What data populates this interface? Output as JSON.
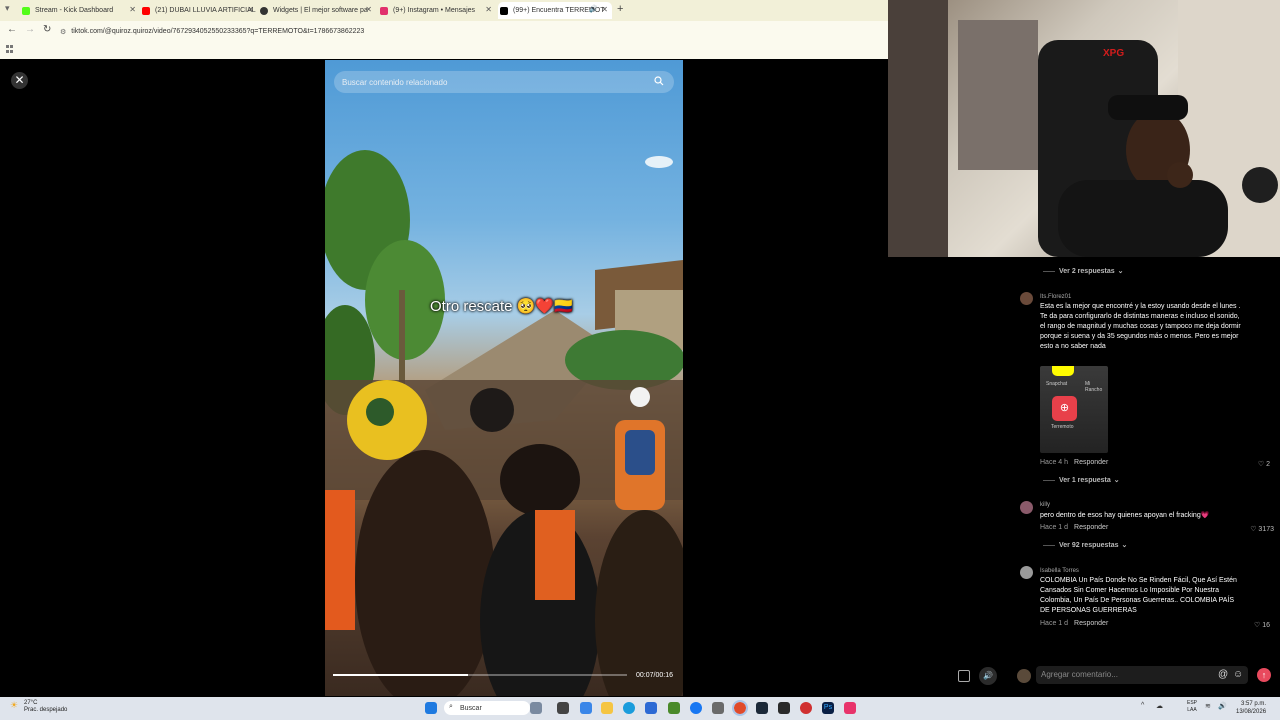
{
  "browser": {
    "tabs": [
      {
        "label": "Stream - Kick Dashboard",
        "icon": "kick-icon",
        "color": "#53fc18"
      },
      {
        "label": "(21) DUBAI LLUVIA ARTIFICIAL",
        "icon": "youtube-icon",
        "color": "#ff0000"
      },
      {
        "label": "Widgets | El mejor software pa",
        "icon": "widgets-icon",
        "color": "#333333"
      },
      {
        "label": "(9+) Instagram • Mensajes",
        "icon": "instagram-icon",
        "color": "#e1306c"
      },
      {
        "label": "(99+) Encuentra TERREMOT",
        "icon": "tiktok-icon",
        "color": "#000000"
      }
    ],
    "url": "tiktok.com/@quiroz.quiroz/video/7672934052550233365?q=TERREMOTO&t=1786673862223"
  },
  "video": {
    "search_placeholder": "Buscar contenido relacionado",
    "caption": "Otro rescate 🥺❤️🇨🇴",
    "time": "00:07/00:16",
    "progress": 0.46
  },
  "comments": {
    "toggle1": "Ver 2 respuestas",
    "c1": {
      "user": "Its.Florez01",
      "text": "Esta es la mejor que encontré y la estoy usando desde el lunes . Te da para configurarlo de distintas maneras e incluso el sonido, el rango de magnitud y muchas cosas y tampoco me deja dormir porque si suena y da 35 segundos más o menos. Pero es mejor esto a no saber nada",
      "thumb_labels": [
        "Snapchat",
        "Mi Rancho",
        "Terremoto"
      ],
      "time": "Hace 4 h",
      "reply": "Responder",
      "likes": "2"
    },
    "toggle2": "Ver 1 respuesta",
    "c2": {
      "user": "killy",
      "text": "pero dentro de esos hay quienes apoyan el fracking💗",
      "time": "Hace 1 d",
      "reply": "Responder",
      "likes": "3173"
    },
    "toggle3": "Ver 92 respuestas",
    "c3": {
      "user": "Isabella Torres",
      "text": "COLOMBIA Un País Donde No Se Rinden Fácil, Que Así Estén Cansados Sin Comer Hacemos Lo Imposible Por Nuestra Colombia, Un País De Personas Guerreras.. COLOMBIA PAÍS DE PERSONAS GUERRERAS",
      "time": "Hace 1 d",
      "reply": "Responder",
      "likes": "16"
    },
    "input_placeholder": "Agregar comentario..."
  },
  "taskbar": {
    "weather_temp": "27°C",
    "weather_desc": "Prac. despejado",
    "search": "Buscar",
    "lang1": "ESP",
    "lang2": "LAA",
    "time": "3:57 p.m.",
    "date": "13/08/2026"
  }
}
